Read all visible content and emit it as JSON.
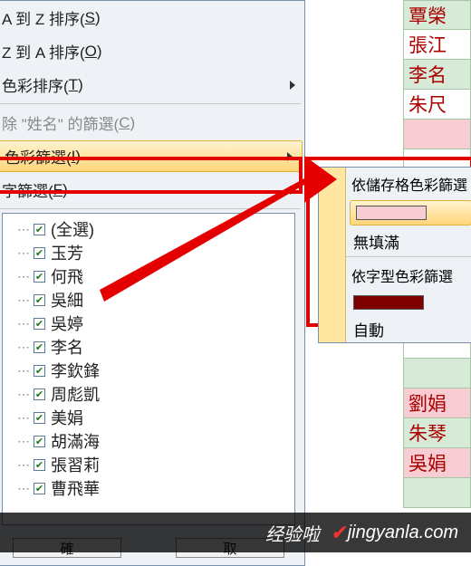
{
  "menu": {
    "sort_az": " A 到 Z 排序(",
    "sort_az_u": "S",
    "sort_az_end": ")",
    "sort_za": " Z 到 A 排序(",
    "sort_za_u": "O",
    "sort_za_end": ")",
    "sort_color": "色彩排序(",
    "sort_color_u": "T",
    "sort_color_end": ")",
    "clear": "除 \"姓名\" 的篩選(",
    "clear_u": "C",
    "clear_end": ")",
    "color_filter": "色彩篩選(",
    "color_filter_u": "I",
    "color_filter_end": ")",
    "text_filter": "字篩選(",
    "text_filter_u": "F",
    "text_filter_end": ")"
  },
  "list": {
    "items": [
      "(全選)",
      "玉芳",
      "何飛",
      "吳細",
      "吳婷",
      "李名",
      "李欽鋒",
      "周彪凱",
      "美娟",
      "胡滿海",
      "張習莉",
      "曹飛華"
    ]
  },
  "buttons": {
    "ok": "確",
    "cancel": "取"
  },
  "submenu": {
    "by_cell_color": "依儲存格色彩篩選",
    "no_fill": "無填滿",
    "by_font_color": "依字型色彩篩選",
    "auto": "自動"
  },
  "cells": [
    {
      "t": "覃榮",
      "c": "green"
    },
    {
      "t": "張江",
      "c": "white"
    },
    {
      "t": "李名",
      "c": "green"
    },
    {
      "t": "朱尺",
      "c": "white"
    },
    {
      "t": "",
      "c": "pink"
    },
    {
      "t": "",
      "c": "white"
    },
    {
      "t": "",
      "c": "green"
    },
    {
      "t": "",
      "c": "white"
    },
    {
      "t": "",
      "c": "green"
    },
    {
      "t": "",
      "c": "white"
    },
    {
      "t": "",
      "c": "green"
    },
    {
      "t": "",
      "c": "white"
    },
    {
      "t": "",
      "c": "green"
    },
    {
      "t": "劉娟",
      "c": "pink"
    },
    {
      "t": "朱琴",
      "c": "green"
    },
    {
      "t": "吳娟",
      "c": "pink"
    },
    {
      "t": "",
      "c": "green"
    }
  ],
  "wm": {
    "brand": "经验啦",
    "site": "jingyanla.com",
    "v": "✔"
  }
}
